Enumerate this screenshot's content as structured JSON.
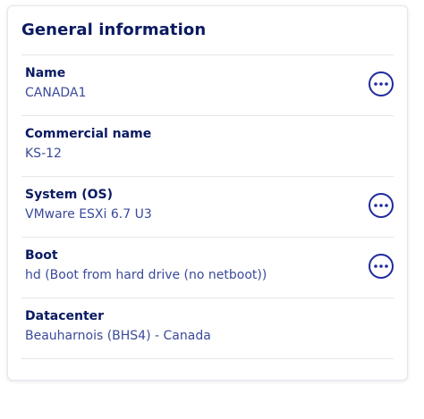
{
  "card": {
    "title": "General information",
    "rows": [
      {
        "label": "Name",
        "value": "CANADA1",
        "has_action": true,
        "action_icon": "ellipsis-icon"
      },
      {
        "label": "Commercial name",
        "value": "KS-12",
        "has_action": false
      },
      {
        "label": "System (OS)",
        "value": "VMware ESXi 6.7 U3",
        "has_action": true,
        "action_icon": "ellipsis-icon"
      },
      {
        "label": "Boot",
        "value": "hd (Boot from hard drive (no netboot))",
        "has_action": true,
        "action_icon": "ellipsis-icon"
      },
      {
        "label": "Datacenter",
        "value": "Beauharnois (BHS4) - Canada",
        "has_action": false
      }
    ]
  },
  "colors": {
    "title": "#0a1a62",
    "label": "#0a1a62",
    "value": "#3a4a99",
    "action_border": "#1e2a9e",
    "divider": "#e5e7ec"
  }
}
